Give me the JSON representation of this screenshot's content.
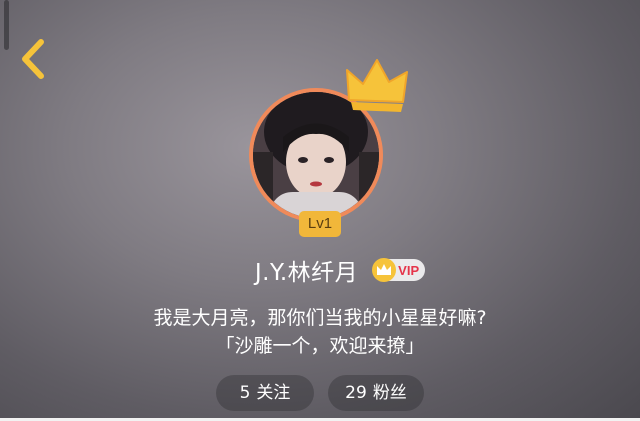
{
  "profile": {
    "username": "J.Y.林纤月",
    "level": "Lv1",
    "vip_label": "VIP",
    "bio_line1": "我是大月亮，那你们当我的小星星好嘛?",
    "bio_line2": "「沙雕一个，欢迎来撩」"
  },
  "stats": {
    "following_count": "5",
    "following_label": "关注",
    "fans_count": "29",
    "fans_label": "粉丝"
  },
  "colors": {
    "avatar_border": "#f08a5a",
    "level_badge": "#f1b73a",
    "crown": "#f6c33a",
    "vip_text": "#e5344a",
    "back_chevron": "#f6c33a"
  },
  "icons": {
    "back": "chevron-left-icon",
    "crown": "crown-icon",
    "vip": "vip-crown-icon"
  }
}
